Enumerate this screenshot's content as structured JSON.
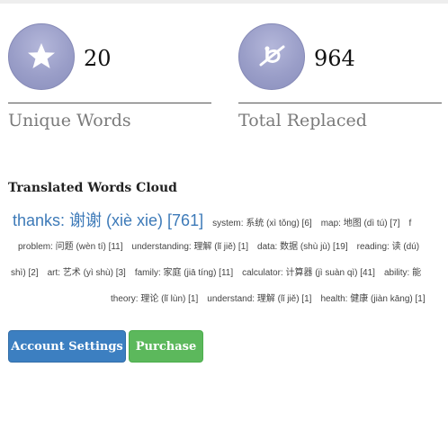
{
  "colors": {
    "accent_blue": "#3c7fc1",
    "accent_green": "#5cb85c",
    "stat_circle": "#9a9ec8"
  },
  "stats": [
    {
      "icon": "star-icon",
      "value": "20",
      "label": "Unique Words"
    },
    {
      "icon": "translate-icon",
      "value": "964",
      "label": "Total Replaced"
    }
  ],
  "cloud": {
    "title": "Translated Words Cloud",
    "lines": [
      [
        "thanks: 谢谢 (xiè xie) [761]",
        "system: 系统 (xì tǒng) [6]",
        "map: 地图 (dì tú) [7]",
        "f"
      ],
      [
        "problem: 问题 (wèn tí) [11]",
        "understanding: 理解 (lǐ jiě) [1]",
        "data: 数据 (shù jù) [19]",
        "reading: 读 (dú)"
      ],
      [
        "shì) [2]",
        "art: 艺术 (yì shù) [3]",
        "family: 家庭 (jiā tíng) [11]",
        "calculator: 计算器 (jì suàn qì) [41]",
        "ability: 能"
      ],
      [
        "theory: 理论 (lǐ lùn) [1]",
        "understand: 理解 (lǐ jiě) [1]",
        "health: 健康 (jiàn kāng) [1]"
      ]
    ]
  },
  "buttons": {
    "settings": "Account Settings",
    "purchase": "Purchase"
  }
}
